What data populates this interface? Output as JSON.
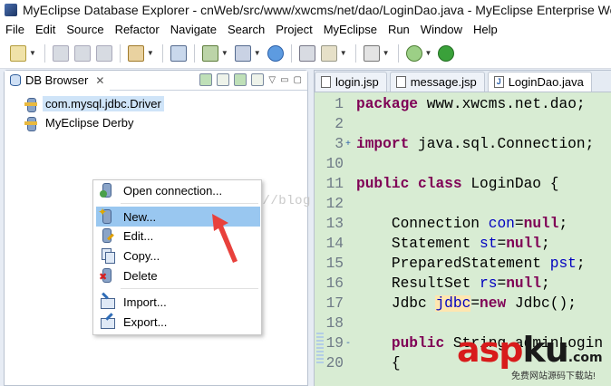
{
  "window": {
    "title": "MyEclipse Database Explorer - cnWeb/src/www/xwcms/net/dao/LoginDao.java - MyEclipse Enterprise Wo"
  },
  "menu": [
    "File",
    "Edit",
    "Source",
    "Refactor",
    "Navigate",
    "Search",
    "Project",
    "MyEclipse",
    "Run",
    "Window",
    "Help"
  ],
  "left_panel": {
    "tab_label": "DB Browser",
    "close_glyph": "✕",
    "tree": [
      {
        "label": "com.mysql.jdbc.Driver",
        "selected": true
      },
      {
        "label": "MyEclipse Derby",
        "selected": false
      }
    ],
    "watermark": "http://blog.csdn.net/"
  },
  "context_menu": {
    "items": [
      {
        "label": "Open connection...",
        "icon": "open-connection-icon",
        "highlighted": false
      },
      {
        "label": "New...",
        "icon": "new-connection-icon",
        "highlighted": true
      },
      {
        "label": "Edit...",
        "icon": "edit-icon",
        "highlighted": false
      },
      {
        "label": "Copy...",
        "icon": "copy-icon",
        "highlighted": false
      },
      {
        "label": "Delete",
        "icon": "delete-icon",
        "highlighted": false
      },
      {
        "label": "Import...",
        "icon": "import-icon",
        "highlighted": false
      },
      {
        "label": "Export...",
        "icon": "export-icon",
        "highlighted": false
      }
    ]
  },
  "editor": {
    "tabs": [
      {
        "label": "login.jsp",
        "active": false
      },
      {
        "label": "message.jsp",
        "active": false
      },
      {
        "label": "LoginDao.java",
        "active": true
      }
    ],
    "lines": [
      {
        "num": "1",
        "fold": "",
        "text": "package www.xwcms.net.dao;"
      },
      {
        "num": "2",
        "fold": "",
        "text": ""
      },
      {
        "num": "3",
        "fold": "+",
        "text": "import java.sql.Connection;"
      },
      {
        "num": "10",
        "fold": "",
        "text": ""
      },
      {
        "num": "11",
        "fold": "",
        "text": "public class LoginDao {"
      },
      {
        "num": "12",
        "fold": "",
        "text": ""
      },
      {
        "num": "13",
        "fold": "",
        "text": "    Connection con=null;"
      },
      {
        "num": "14",
        "fold": "",
        "text": "    Statement st=null;"
      },
      {
        "num": "15",
        "fold": "",
        "text": "    PreparedStatement pst;"
      },
      {
        "num": "16",
        "fold": "",
        "text": "    ResultSet rs=null;"
      },
      {
        "num": "17",
        "fold": "",
        "text": "    Jdbc jdbc=new Jdbc();"
      },
      {
        "num": "18",
        "fold": "",
        "text": ""
      },
      {
        "num": "19",
        "fold": "-",
        "text": "    public String adminLogin"
      },
      {
        "num": "20",
        "fold": "",
        "text": "    {"
      }
    ]
  },
  "logo": {
    "main_a": "asp",
    "main_b": "ku",
    "suffix": ".com",
    "sub": "免费网站源码下载站!"
  },
  "colors": {
    "editor_bg": "#d8ecd3",
    "keyword": "#7f0055",
    "field": "#0000c0",
    "menu_highlight": "#99c7f0",
    "tree_selection": "#cfe4f8",
    "arrow": "#e8413c"
  }
}
